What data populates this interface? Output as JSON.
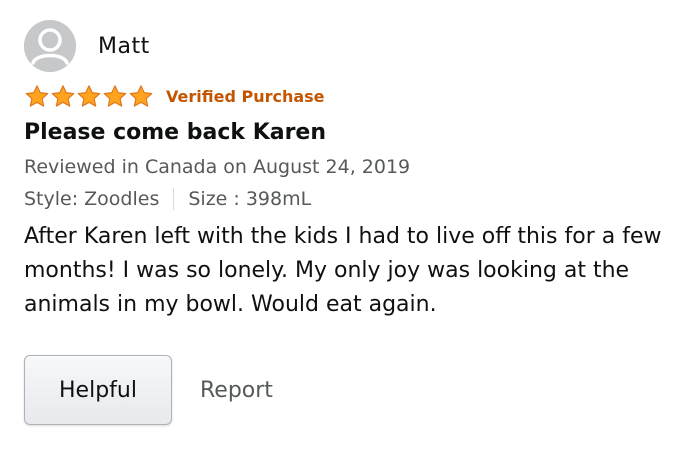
{
  "reviewer": {
    "name": "Matt",
    "avatar_icon": "user-silhouette-icon"
  },
  "rating": {
    "stars": 5,
    "max_stars": 5,
    "star_color": "#ffa41c",
    "verified_label": "Verified Purchase",
    "verified_color": "#c45500"
  },
  "review": {
    "title": "Please come back Karen",
    "date_line": "Reviewed in Canada on August 24, 2019",
    "style_label": "Style: Zoodles",
    "size_label": "Size : 398mL",
    "body": "After Karen left with the kids I had to live off this for a few months! I was so lonely. My only joy was looking at the animals in my bowl. Would eat again."
  },
  "actions": {
    "helpful_label": "Helpful",
    "report_label": "Report"
  }
}
